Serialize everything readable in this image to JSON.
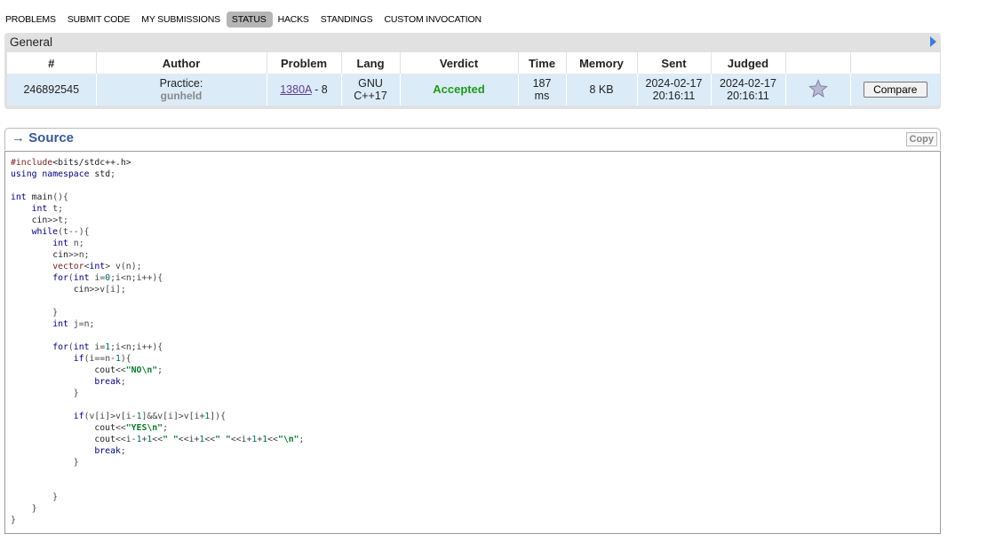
{
  "nav": {
    "items": [
      "Problems",
      "Submit Code",
      "My Submissions",
      "Status",
      "Hacks",
      "Standings",
      "Custom Invocation"
    ],
    "active": "Status"
  },
  "general": {
    "title": "General",
    "columns": [
      "#",
      "Author",
      "Problem",
      "Lang",
      "Verdict",
      "Time",
      "Memory",
      "Sent",
      "Judged",
      "",
      ""
    ],
    "row": {
      "id": "246892545",
      "author_type": "Practice:",
      "author_handle": "gunheld",
      "problem_code": "1380A",
      "problem_suffix": " - 8",
      "lang_line1": "GNU",
      "lang_line2": "C++17",
      "verdict": "Accepted",
      "verdict_color": "#1f9b1f",
      "time_value": "187",
      "time_unit": "ms",
      "memory": "8 KB",
      "sent_date": "2024-02-17",
      "sent_time": "20:16:11",
      "judged_date": "2024-02-17",
      "judged_time": "20:16:11",
      "favorite_icon": "star-icon",
      "compare_label": "Compare"
    }
  },
  "source": {
    "title": "→ Source",
    "copy_label": "Copy",
    "code_lines": [
      "#include<bits/stdc++.h>",
      "using namespace std;",
      "",
      "int main(){",
      "    int t;",
      "    cin>>t;",
      "    while(t--){",
      "        int n;",
      "        cin>>n;",
      "        vector<int> v(n);",
      "        for(int i=0;i<n;i++){",
      "            cin>>v[i];",
      "",
      "        }",
      "        int j=n;",
      "",
      "        for(int i=1;i<n;i++){",
      "            if(i==n-1){",
      "                cout<<\"NO\\n\";",
      "                break;",
      "            }",
      "",
      "            if(v[i]>v[i-1]&&v[i]>v[i+1]){",
      "                cout<<\"YES\\n\";",
      "                cout<<i-1+1<<\" \"<<i+1<<\" \"<<i+1+1<<\"\\n\";",
      "                break;",
      "            }",
      "",
      "",
      "        }",
      "    }",
      "}"
    ]
  }
}
